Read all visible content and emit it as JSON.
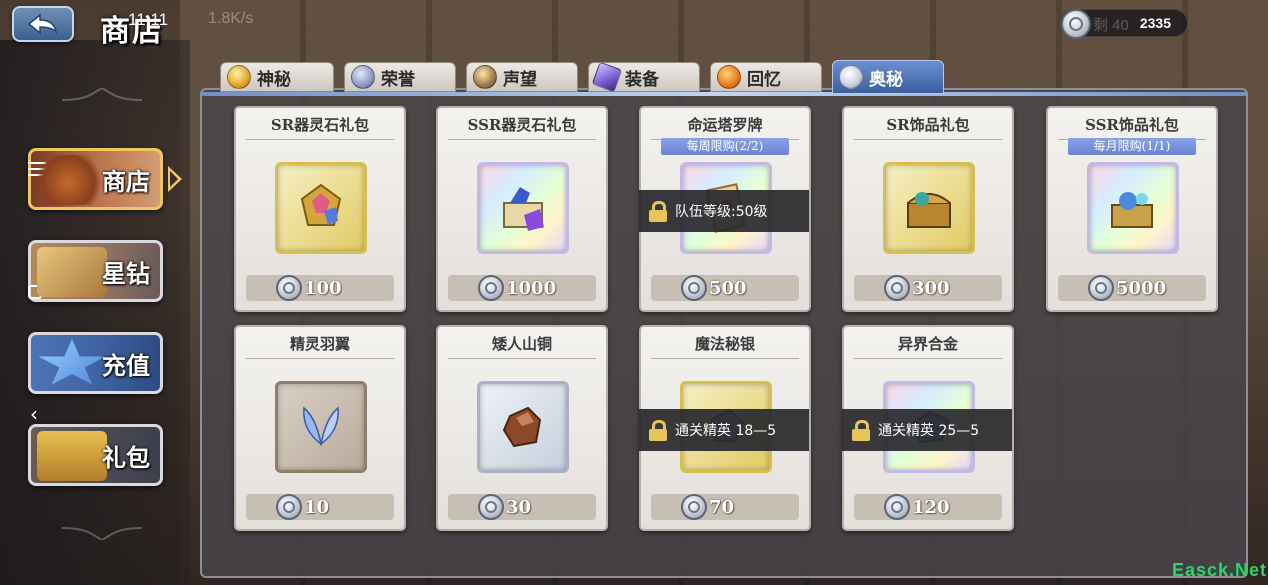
{
  "header": {
    "title": "商店",
    "status_time": "11:11",
    "status_speed": "1.8K/s",
    "currency_ghost": "剩 40",
    "currency_amount": "2335"
  },
  "side_nav": {
    "items": [
      {
        "label": "商店",
        "active": true
      },
      {
        "label": "星钻",
        "active": false
      },
      {
        "label": "充值",
        "active": false
      },
      {
        "label": "礼包",
        "active": false
      }
    ]
  },
  "tabs": [
    {
      "label": "神秘",
      "icon": "mystery-coin-icon"
    },
    {
      "label": "荣誉",
      "icon": "honor-badge-icon"
    },
    {
      "label": "声望",
      "icon": "fame-crest-icon"
    },
    {
      "label": "装备",
      "icon": "equipment-crystal-icon"
    },
    {
      "label": "回忆",
      "icon": "memory-orb-icon"
    },
    {
      "label": "奥秘",
      "icon": "arcane-coin-icon",
      "active": true
    }
  ],
  "cards": [
    {
      "title": "SR器灵石礼包",
      "limit": "",
      "price": "100",
      "lock": ""
    },
    {
      "title": "SSR器灵石礼包",
      "limit": "",
      "price": "1000",
      "lock": ""
    },
    {
      "title": "命运塔罗牌",
      "limit": "每周限购(2/2)",
      "price": "500",
      "lock": "队伍等级:50级"
    },
    {
      "title": "SR饰品礼包",
      "limit": "",
      "price": "300",
      "lock": ""
    },
    {
      "title": "SSR饰品礼包",
      "limit": "每月限购(1/1)",
      "price": "5000",
      "lock": ""
    },
    {
      "title": "精灵羽翼",
      "limit": "",
      "price": "10",
      "lock": ""
    },
    {
      "title": "矮人山铜",
      "limit": "",
      "price": "30",
      "lock": ""
    },
    {
      "title": "魔法秘银",
      "limit": "",
      "price": "70",
      "lock": "通关精英 18—5"
    },
    {
      "title": "异界合金",
      "limit": "",
      "price": "120",
      "lock": "通关精英 25—5"
    }
  ],
  "watermark": "Easck.Net",
  "colors": {
    "active_tab": "#3d5f9f",
    "limit_badge": "#6d84d4",
    "lock_overlay": "#28282c",
    "frame_gold": "#f0c75a"
  }
}
